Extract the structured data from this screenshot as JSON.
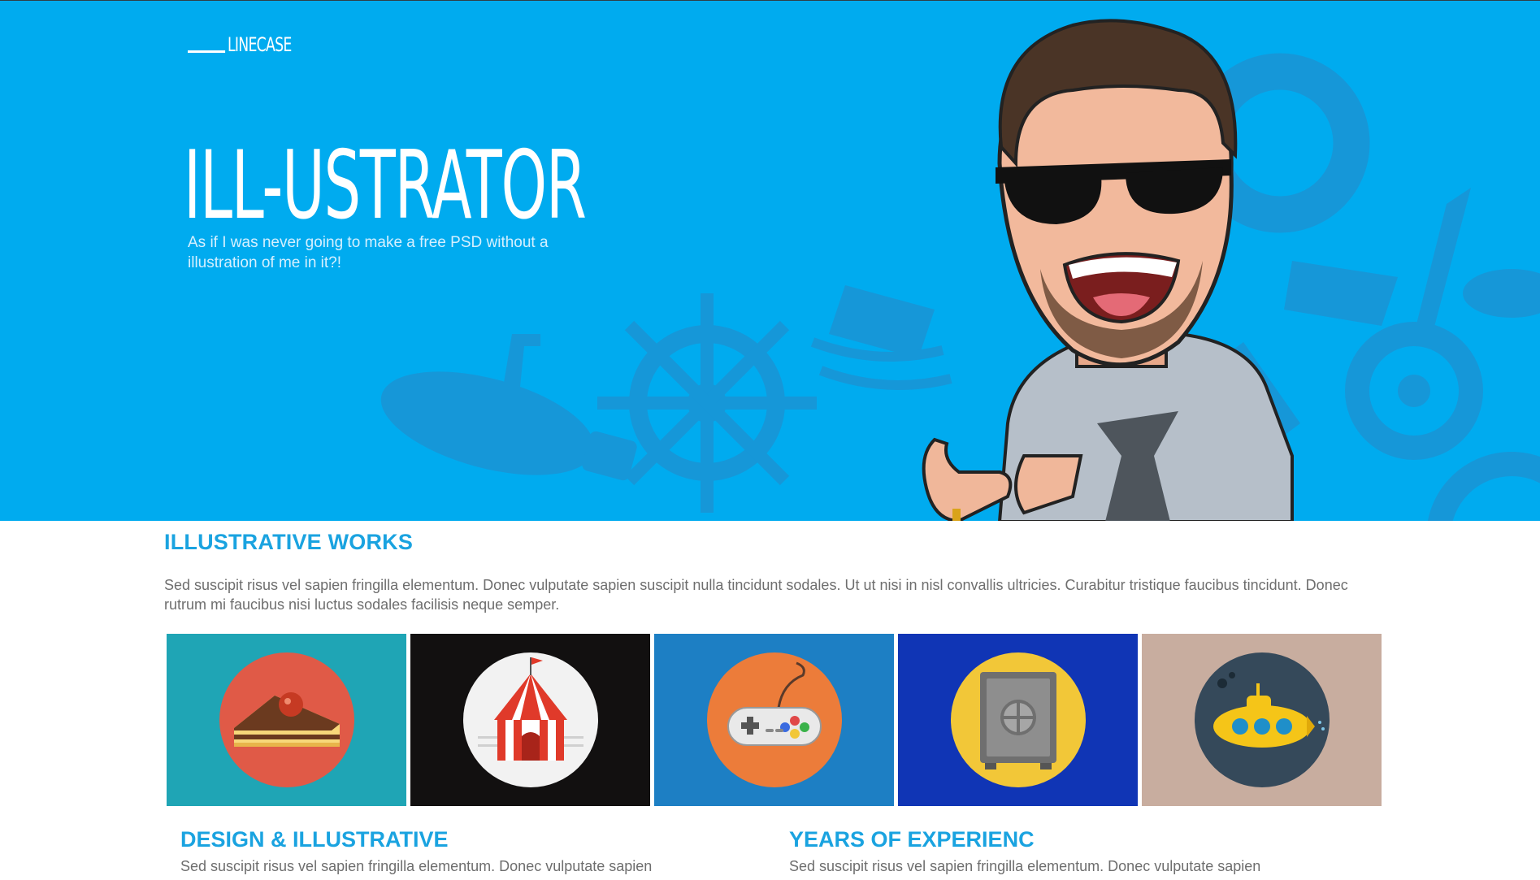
{
  "brand": {
    "logo_text": "LINECASE"
  },
  "hero": {
    "title": "ILL-USTRATOR",
    "subtitle": "As if I was never going to make a free PSD without a illustration of me in it?!"
  },
  "works": {
    "title": "ILLUSTRATIVE WORKS",
    "description": "Sed suscipit risus vel sapien fringilla elementum. Donec vulputate sapien suscipit nulla tincidunt sodales. Ut ut nisi in nisl convallis ultricies. Curabitur tristique faucibus tincidunt. Donec rutrum mi faucibus nisi luctus sodales facilisis neque semper.",
    "tiles": [
      {
        "icon": "cake-icon",
        "bg": "#1fa5b5",
        "circle": "#e05a47"
      },
      {
        "icon": "circus-tent-icon",
        "bg": "#121010",
        "circle": "#f2f2f2"
      },
      {
        "icon": "gamepad-icon",
        "bg": "#1d7fc4",
        "circle": "#ec7c3a"
      },
      {
        "icon": "safe-icon",
        "bg": "#1035b5",
        "circle": "#f2c738"
      },
      {
        "icon": "submarine-icon",
        "bg": "#c8ad9f",
        "circle": "#35495a"
      }
    ]
  },
  "columns": [
    {
      "title": "DESIGN & ILLUSTRATIVE",
      "text": "Sed suscipit risus vel sapien fringilla elementum. Donec vulputate sapien"
    },
    {
      "title": "YEARS OF EXPERIENC",
      "text": "Sed suscipit risus vel sapien fringilla elementum. Donec vulputate sapien"
    }
  ],
  "colors": {
    "hero_bg": "#00abef",
    "accent": "#1aa3e0"
  }
}
